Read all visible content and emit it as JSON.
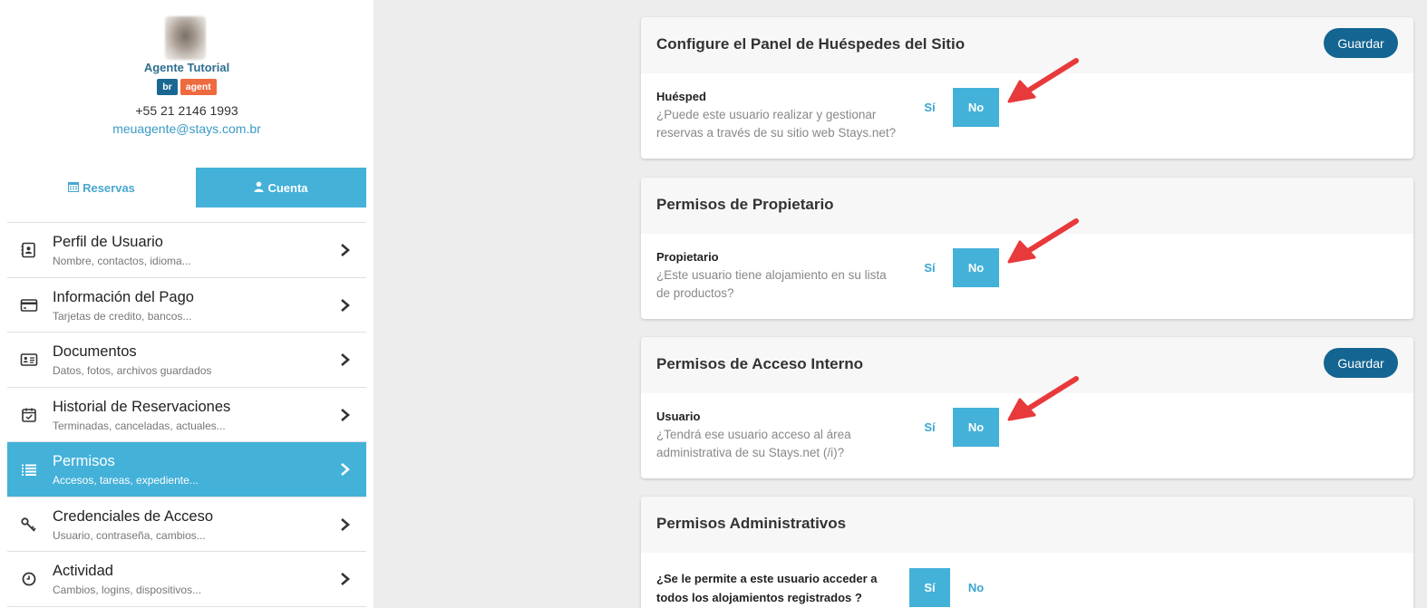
{
  "profile": {
    "name": "Agente Tutorial",
    "badges": [
      "br",
      "agent"
    ],
    "phone": "+55 21 2146 1993",
    "email": "meuagente@stays.com.br"
  },
  "tabs": [
    {
      "label": "Reservas",
      "icon": "calendar-icon",
      "active": false
    },
    {
      "label": "Cuenta",
      "icon": "user-icon",
      "active": true
    }
  ],
  "menu": [
    {
      "title": "Perfil de Usuario",
      "subtitle": "Nombre, contactos, idioma...",
      "icon": "contact-card-icon"
    },
    {
      "title": "Información del Pago",
      "subtitle": "Tarjetas de credito, bancos...",
      "icon": "credit-card-icon"
    },
    {
      "title": "Documentos",
      "subtitle": "Datos, fotos, archivos guardados",
      "icon": "id-card-icon"
    },
    {
      "title": "Historial de Reservaciones",
      "subtitle": "Terminadas, canceladas, actuales...",
      "icon": "calendar-check-icon"
    },
    {
      "title": "Permisos",
      "subtitle": "Accesos, tareas, expediente...",
      "icon": "list-icon",
      "active": true
    },
    {
      "title": "Credenciales de Acceso",
      "subtitle": "Usuario, contraseña, cambios...",
      "icon": "key-icon"
    },
    {
      "title": "Actividad",
      "subtitle": "Cambios, logins, dispositivos...",
      "icon": "clock-icon"
    }
  ],
  "cards": [
    {
      "title": "Configure el Panel de Huéspedes del Sitio",
      "save_label": "Guardar",
      "row": {
        "label": "Huésped",
        "desc": "¿Puede este usuario realizar y gestionar reservas a través de su sitio web Stays.net?",
        "yes": "Sí",
        "no": "No",
        "selected": "No"
      }
    },
    {
      "title": "Permisos de Propietario",
      "row": {
        "label": "Propietario",
        "desc": "¿Este usuario tiene alojamiento en su lista de productos?",
        "yes": "Sí",
        "no": "No",
        "selected": "No"
      }
    },
    {
      "title": "Permisos de Acceso Interno",
      "save_label": "Guardar",
      "row": {
        "label": "Usuario",
        "desc": "¿Tendrá ese usuario acceso al área administrativa de su Stays.net (/i)?",
        "yes": "Sí",
        "no": "No",
        "selected": "No"
      }
    },
    {
      "title": "Permisos Administrativos",
      "row": {
        "label": "¿Se le permite a este usuario acceder a todos los alojamientos registrados ?",
        "yes": "Sí",
        "no": "No",
        "selected": "Sí"
      }
    }
  ],
  "colors": {
    "accent": "#44b1d9",
    "button": "#146591",
    "arrow": "#e8393b",
    "badge_br": "#1a6891",
    "badge_agent": "#ee6a3f"
  }
}
